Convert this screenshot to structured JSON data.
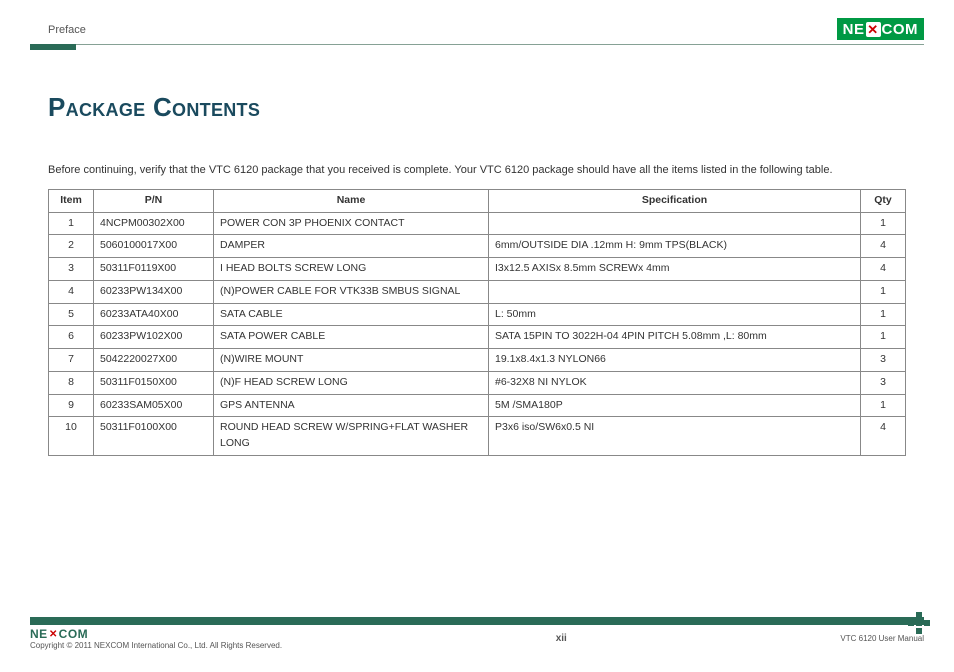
{
  "header": {
    "section": "Preface",
    "brand_left": "NE",
    "brand_right": "COM"
  },
  "title": "Package Contents",
  "intro": "Before continuing, verify that the VTC 6120 package that you received is complete. Your VTC 6120 package should have all the items listed in the following table.",
  "table": {
    "headers": {
      "item": "Item",
      "pn": "P/N",
      "name": "Name",
      "spec": "Specification",
      "qty": "Qty"
    },
    "rows": [
      {
        "item": "1",
        "pn": "4NCPM00302X00",
        "name": "POWER CON 3P PHOENIX CONTACT",
        "spec": "",
        "qty": "1"
      },
      {
        "item": "2",
        "pn": "5060100017X00",
        "name": "DAMPER",
        "spec": "6mm/OUTSIDE DIA .12mm H: 9mm TPS(BLACK)",
        "qty": "4"
      },
      {
        "item": "3",
        "pn": "50311F0119X00",
        "name": "I HEAD BOLTS SCREW LONG",
        "spec": "I3x12.5 AXISx 8.5mm SCREWx 4mm",
        "qty": "4"
      },
      {
        "item": "4",
        "pn": "60233PW134X00",
        "name": "(N)POWER CABLE FOR VTK33B SMBUS SIGNAL",
        "spec": "",
        "qty": "1"
      },
      {
        "item": "5",
        "pn": "60233ATA40X00",
        "name": "SATA CABLE",
        "spec": "L: 50mm",
        "qty": "1"
      },
      {
        "item": "6",
        "pn": "60233PW102X00",
        "name": "SATA POWER CABLE",
        "spec": "SATA 15PIN TO 3022H-04 4PIN PITCH 5.08mm ,L: 80mm",
        "qty": "1"
      },
      {
        "item": "7",
        "pn": "5042220027X00",
        "name": "(N)WIRE MOUNT",
        "spec": "19.1x8.4x1.3 NYLON66",
        "qty": "3"
      },
      {
        "item": "8",
        "pn": "50311F0150X00",
        "name": "(N)F HEAD SCREW LONG",
        "spec": "#6-32X8 NI NYLOK",
        "qty": "3"
      },
      {
        "item": "9",
        "pn": "60233SAM05X00",
        "name": "GPS ANTENNA",
        "spec": "5M /SMA180P",
        "qty": "1"
      },
      {
        "item": "10",
        "pn": "50311F0100X00",
        "name": "ROUND HEAD SCREW W/SPRING+FLAT WASHER LONG",
        "spec": "P3x6 iso/SW6x0.5 NI",
        "qty": "4"
      }
    ]
  },
  "footer": {
    "copyright": "Copyright © 2011 NEXCOM International Co., Ltd. All Rights Reserved.",
    "page": "xii",
    "doc": "VTC 6120 User Manual"
  }
}
